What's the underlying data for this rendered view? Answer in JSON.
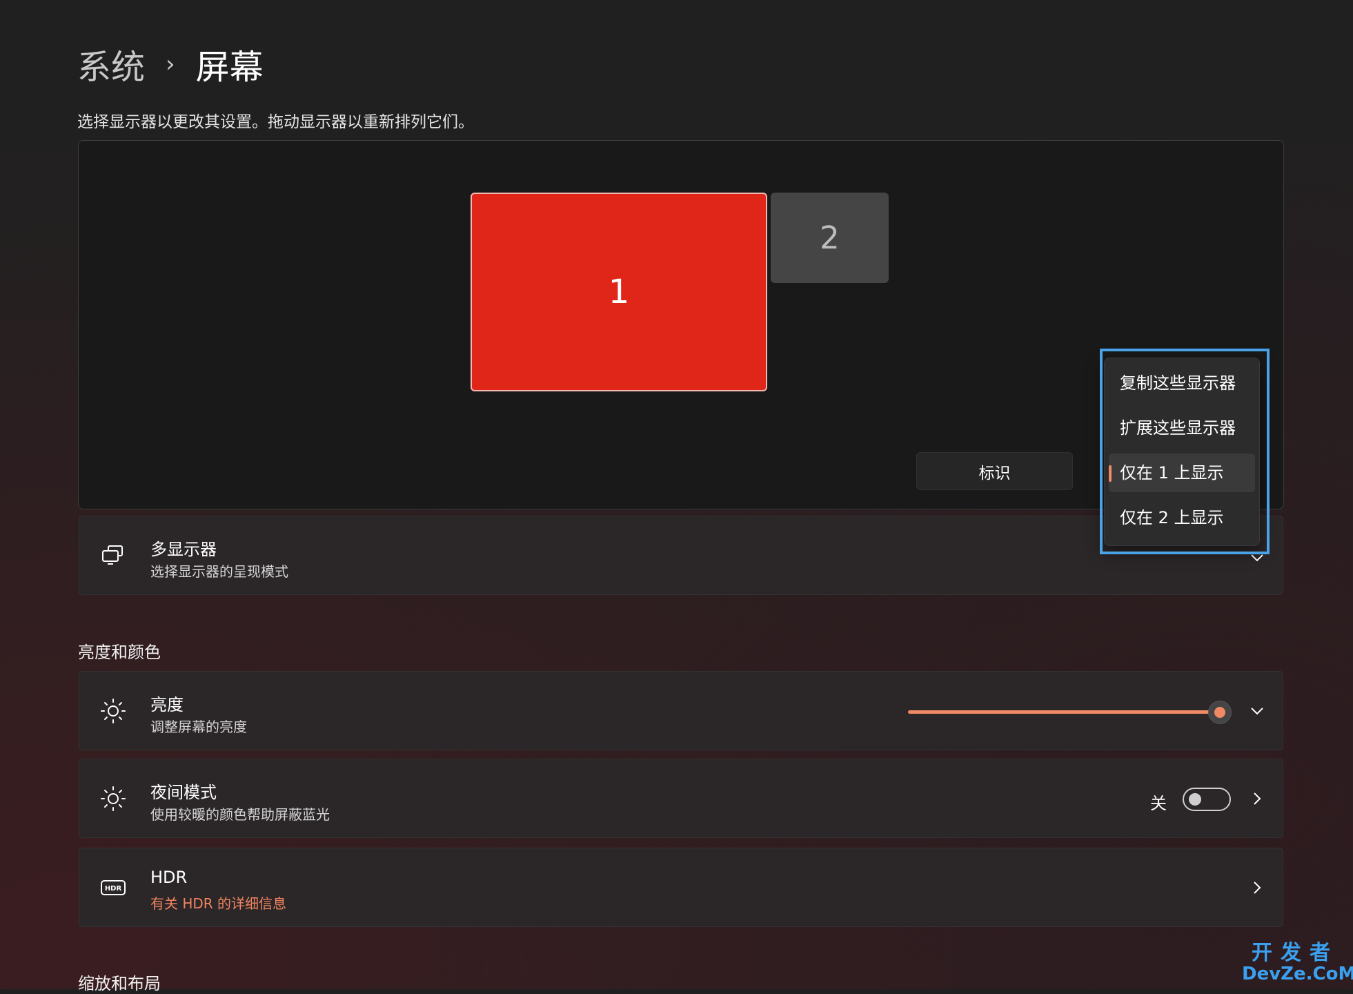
{
  "breadcrumb": {
    "parent": "系统",
    "separator": "›",
    "current": "屏幕"
  },
  "description": "选择显示器以更改其设置。拖动显示器以重新排列它们。",
  "arrangement": {
    "monitors": [
      {
        "label": "1",
        "selected": true
      },
      {
        "label": "2",
        "selected": false
      }
    ],
    "identify_label": "标识"
  },
  "multi_display": {
    "title": "多显示器",
    "subtitle": "选择显示器的呈现模式",
    "icon": "multi-monitor-icon"
  },
  "projection_menu": {
    "items": [
      {
        "label": "复制这些显示器"
      },
      {
        "label": "扩展这些显示器"
      },
      {
        "label": "仅在 1 上显示",
        "selected": true
      },
      {
        "label": "仅在 2 上显示"
      }
    ]
  },
  "brightness_color_section": {
    "heading": "亮度和颜色"
  },
  "brightness": {
    "title": "亮度",
    "subtitle": "调整屏幕的亮度",
    "icon": "sun-icon",
    "level_fraction": 0.97
  },
  "night_light": {
    "title": "夜间模式",
    "subtitle": "使用较暖的颜色帮助屏蔽蓝光",
    "state_label": "关",
    "enabled": false,
    "icon": "night-light-icon"
  },
  "hdr": {
    "title": "HDR",
    "link_text": "有关 HDR 的详细信息",
    "icon": "hdr-icon"
  },
  "scale_layout_section": {
    "heading": "缩放和布局"
  },
  "watermark": {
    "line1": "开发者",
    "line2": "DevZe.CoM"
  },
  "colors": {
    "accent": "#f08a65",
    "monitor_selected": "#e02619",
    "highlight_box": "#4aa3e8"
  }
}
